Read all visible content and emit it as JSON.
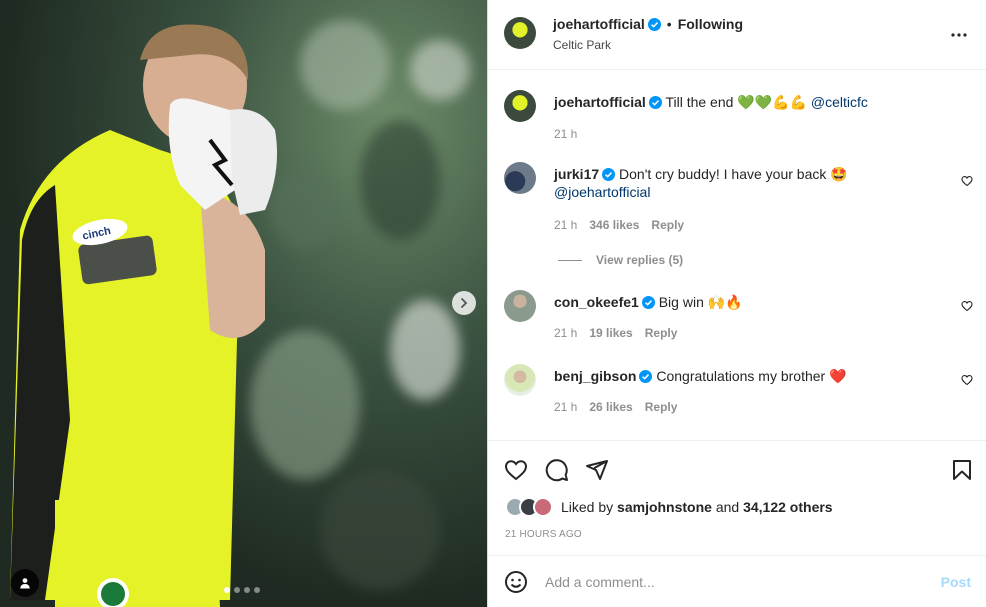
{
  "post": {
    "username": "joehartofficial",
    "separator": "•",
    "follow_status": "Following",
    "location": "Celtic Park",
    "more_icon": "more-horizontal-icon"
  },
  "caption": {
    "username": "joehartofficial",
    "text": "Till the end 💚💚💪💪",
    "mention": "@celticfc",
    "time": "21 h"
  },
  "comments": [
    {
      "username": "jurki17",
      "text": "Don't cry buddy! I have your back 🤩",
      "mention": "@joehartofficial",
      "time": "21 h",
      "likes": "346 likes",
      "reply": "Reply",
      "view_replies": "View replies (5)"
    },
    {
      "username": "con_okeefe1",
      "text": "Big win 🙌🔥",
      "time": "21 h",
      "likes": "19 likes",
      "reply": "Reply"
    },
    {
      "username": "benj_gibson",
      "text": "Congratulations my brother ❤️",
      "time": "21 h",
      "likes": "26 likes",
      "reply": "Reply"
    }
  ],
  "likes": {
    "prefix": "Liked by",
    "user": "samjohnstone",
    "connector": "and",
    "others": "34,122 others"
  },
  "timestamp": "21 HOURS AGO",
  "add_comment": {
    "placeholder": "Add a comment...",
    "post_label": "Post"
  },
  "carousel": {
    "total_slides": 4,
    "active_slide": 1
  },
  "colors": {
    "accent": "#0095f6",
    "verified": "#0095f6",
    "link": "#00376b",
    "kit_yellow": "#e4f227"
  }
}
